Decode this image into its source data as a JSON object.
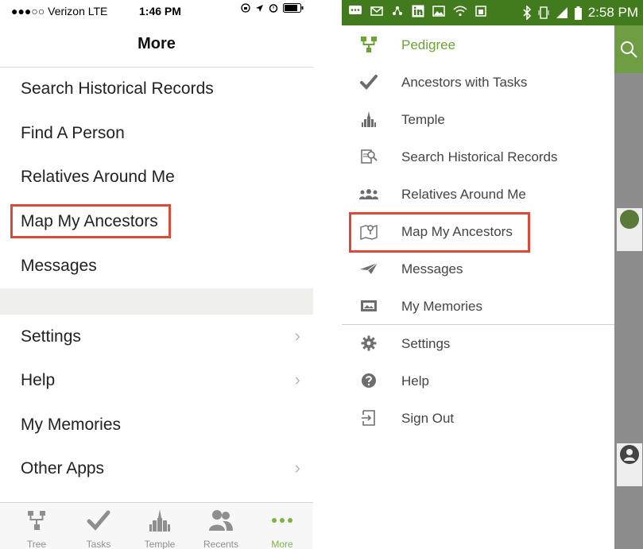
{
  "ios": {
    "status": {
      "left": "●●●○○ Verizon  LTE",
      "time": "1:46 PM",
      "battery": "battery-icon"
    },
    "nav_title": "More",
    "items": [
      {
        "label": "Search Historical Records",
        "chevron": false
      },
      {
        "label": "Find A Person",
        "chevron": false
      },
      {
        "label": "Relatives Around Me",
        "chevron": false
      },
      {
        "label": "Map My Ancestors",
        "chevron": false,
        "highlighted": true
      },
      {
        "label": "Messages",
        "chevron": false
      },
      {
        "label": "Settings",
        "chevron": true
      },
      {
        "label": "Help",
        "chevron": true
      },
      {
        "label": "My Memories",
        "chevron": false
      },
      {
        "label": "Other Apps",
        "chevron": true
      }
    ],
    "chevron_glyph": "›",
    "tabs": [
      {
        "label": "Tree",
        "icon": "tree-icon"
      },
      {
        "label": "Tasks",
        "icon": "check-icon"
      },
      {
        "label": "Temple",
        "icon": "temple-icon"
      },
      {
        "label": "Recents",
        "icon": "people-icon"
      },
      {
        "label": "More",
        "icon": "more-dots-icon",
        "active": true
      }
    ],
    "accent": "#7db441"
  },
  "android": {
    "status": {
      "time": "2:58 PM"
    },
    "items": [
      {
        "label": "Pedigree",
        "icon": "pedigree-icon",
        "active": true
      },
      {
        "label": "Ancestors with Tasks",
        "icon": "check-icon"
      },
      {
        "label": "Temple",
        "icon": "temple-icon"
      },
      {
        "label": "Search Historical Records",
        "icon": "search-records-icon"
      },
      {
        "label": "Relatives Around Me",
        "icon": "people-icon"
      },
      {
        "label": "Map My Ancestors",
        "icon": "map-pin-icon",
        "highlighted": true
      },
      {
        "label": "Messages",
        "icon": "paper-plane-icon"
      },
      {
        "label": "My Memories",
        "icon": "photo-icon"
      },
      {
        "label": "Settings",
        "icon": "gear-icon"
      },
      {
        "label": "Help",
        "icon": "help-icon"
      },
      {
        "label": "Sign Out",
        "icon": "sign-out-icon"
      }
    ],
    "statusbar_color": "#427a1e",
    "highlight_color": "#d94b36"
  }
}
